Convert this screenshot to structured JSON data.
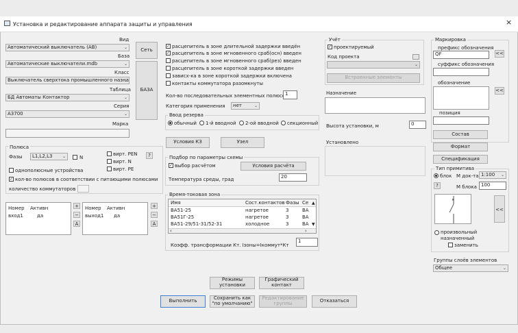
{
  "window": {
    "title": "Установка и редактирование аппарата защиты и управления",
    "close": "×"
  },
  "left": {
    "vid_label": "Вид",
    "vid_value": "Автоматический выключатель (АВ)",
    "baza_label": "База",
    "baza_value": "Автоматические выключатели.mdb",
    "klass_label": "Класс",
    "klass_value": "Выключатель сверхтока промышленного назначе",
    "table_label": "Таблица",
    "table_value": "БД Автоматы Контактор",
    "seria_label": "Серия",
    "seria_value": "А3700",
    "marka_label": "Марка",
    "set_button": "Сеть",
    "baza_button": "БАЗА",
    "poles_title": "Полюса",
    "phases_label": "Фазы",
    "phases_value": "L1,L2,L3",
    "n_label": "N",
    "virt_pen": "вирт. PEN",
    "virt_n": "вирт. N",
    "virt_pe": "вирт. PE",
    "help": "?",
    "single_pole": "однополюсные устройства",
    "poles_match": "кол-во полюсов в соответствии с питающими полюсами",
    "commutator_count": "количество коммутаторов",
    "in_headers": [
      "Номер",
      "Активн"
    ],
    "in_rows": [
      [
        "вход1",
        "да"
      ]
    ],
    "out_headers": [
      "Номер",
      "Активн"
    ],
    "out_rows": [
      [
        "выход1",
        "да"
      ]
    ],
    "plus": "+",
    "minus": "−",
    "a": "A"
  },
  "middle": {
    "checks": [
      {
        "label": "расцепитель в зоне длительной задержки введён",
        "checked": true
      },
      {
        "label": "расцепитель в зоне мгновенного сраб(осн) введен",
        "checked": true
      },
      {
        "label": "расцепитель в зоне мгновенного сраб(рез) введен",
        "checked": false
      },
      {
        "label": "расцепитель в зоне короткой задержки введен",
        "checked": false
      },
      {
        "label": "зависх-ка в зоне короткой задержки включена",
        "checked": false
      },
      {
        "label": "контакты коммутатора разомкнуты",
        "checked": false
      }
    ],
    "series_poles_label": "Кол-во последовательных элементных полюсов",
    "series_poles_value": "1",
    "category_label": "Категория применения",
    "category_value": "нет",
    "reserve_title": "Ввод резерва",
    "reserve_opts": [
      "обычный",
      "1-й вводной",
      "2-ой вводной",
      "секционный"
    ],
    "kz_button": "Условия КЗ",
    "node_button": "Узел",
    "params_title": "Подбор по параметры схемы",
    "calc_choice": "выбор расчётом",
    "calc_conditions": "Условия расчёта",
    "temp_label": "Температура среды, град",
    "temp_value": "20",
    "zone_title": "Время-токовая зона",
    "zone_headers": [
      "Имя",
      "Сост.контактов",
      "Фазы",
      "Се"
    ],
    "zone_rows": [
      [
        "ВА51-25",
        "нагретое",
        "3",
        "ВА"
      ],
      [
        "ВА51Г-25",
        "нагретое",
        "3",
        "ВА"
      ],
      [
        "ВА51-29/51-31/52-31",
        "холодное",
        "3",
        "ВА"
      ]
    ],
    "coef_label": "Коэфф. трансформации Кт. Iзоны=Iкоммут*Кт",
    "coef_value": "1"
  },
  "right": {
    "uchet_title": "Учёт",
    "designed": "проектируемый",
    "project_code": "Код проекта",
    "builtin": "Встроенные элементы",
    "purpose_title": "Назначение",
    "install_height": "Высота установки, м",
    "install_height_value": "0",
    "installed": "Установлено"
  },
  "marking": {
    "title": "Маркировка",
    "prefix_label": "префикс обозначения",
    "prefix_value": "QF",
    "suffix_label": "суффикс обозначения",
    "designation_label": "обозначение",
    "position_label": "позиция",
    "arrows": "<<",
    "sostav": "Состав",
    "format": "Формат",
    "spec": "Спецификация",
    "prim_title": "Тип примитива",
    "block": "блок",
    "m_doc": "М док-та",
    "m_doc_value": "1:100",
    "m_block": "М блока",
    "m_block_value": "100",
    "help": "?",
    "arbitrary": "произвольный назначенный",
    "replace": "заменить",
    "layers_title": "Группы слоёв элементов",
    "layers_value": "Общее"
  },
  "bottom": {
    "modes": "Режимы установки",
    "graphic_contact": "Графический контакт",
    "execute": "Выполнить",
    "save_default": "Сохранить как \"по умолчанию\"",
    "edit_group": "Редактирование группы",
    "cancel": "Отказаться"
  }
}
